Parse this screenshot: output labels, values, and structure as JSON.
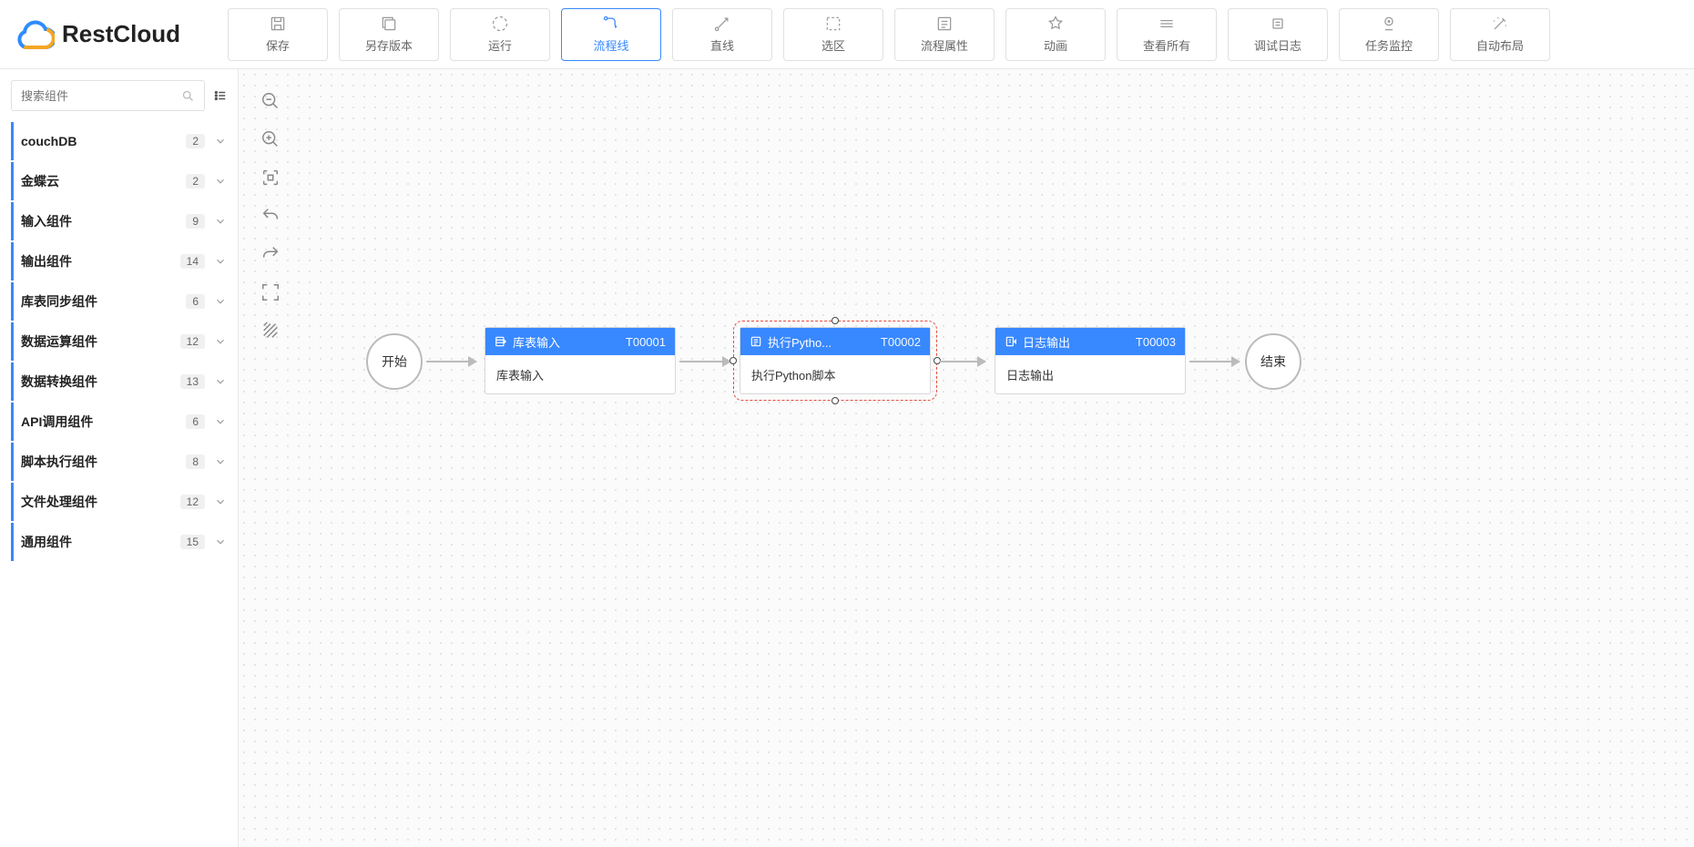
{
  "brand": "RestCloud",
  "toolbar": [
    {
      "id": "save",
      "label": "保存",
      "active": false,
      "icon": "save-icon"
    },
    {
      "id": "saveas",
      "label": "另存版本",
      "active": false,
      "icon": "copy-icon"
    },
    {
      "id": "run",
      "label": "运行",
      "active": false,
      "icon": "run-icon"
    },
    {
      "id": "flowline",
      "label": "流程线",
      "active": true,
      "icon": "flowline-icon"
    },
    {
      "id": "line",
      "label": "直线",
      "active": false,
      "icon": "line-icon"
    },
    {
      "id": "select",
      "label": "选区",
      "active": false,
      "icon": "select-icon"
    },
    {
      "id": "props",
      "label": "流程属性",
      "active": false,
      "icon": "props-icon"
    },
    {
      "id": "anim",
      "label": "动画",
      "active": false,
      "icon": "star-icon"
    },
    {
      "id": "viewall",
      "label": "查看所有",
      "active": false,
      "icon": "viewall-icon"
    },
    {
      "id": "debuglog",
      "label": "调试日志",
      "active": false,
      "icon": "debuglog-icon"
    },
    {
      "id": "taskmon",
      "label": "任务监控",
      "active": false,
      "icon": "monitor-icon"
    },
    {
      "id": "autolayout",
      "label": "自动布局",
      "active": false,
      "icon": "wand-icon"
    }
  ],
  "sidebar": {
    "search_placeholder": "搜索组件",
    "categories": [
      {
        "label": "couchDB",
        "count": "2"
      },
      {
        "label": "金蝶云",
        "count": "2"
      },
      {
        "label": "输入组件",
        "count": "9"
      },
      {
        "label": "输出组件",
        "count": "14"
      },
      {
        "label": "库表同步组件",
        "count": "6"
      },
      {
        "label": "数据运算组件",
        "count": "12"
      },
      {
        "label": "数据转换组件",
        "count": "13"
      },
      {
        "label": "API调用组件",
        "count": "6"
      },
      {
        "label": "脚本执行组件",
        "count": "8"
      },
      {
        "label": "文件处理组件",
        "count": "12"
      },
      {
        "label": "通用组件",
        "count": "15"
      }
    ]
  },
  "canvas": {
    "start_label": "开始",
    "end_label": "结束",
    "nodes": [
      {
        "title": "库表输入",
        "id": "T00001",
        "body": "库表输入",
        "selected": false
      },
      {
        "title": "执行Pytho...",
        "id": "T00002",
        "body": "执行Python脚本",
        "selected": true
      },
      {
        "title": "日志输出",
        "id": "T00003",
        "body": "日志输出",
        "selected": false
      }
    ]
  }
}
